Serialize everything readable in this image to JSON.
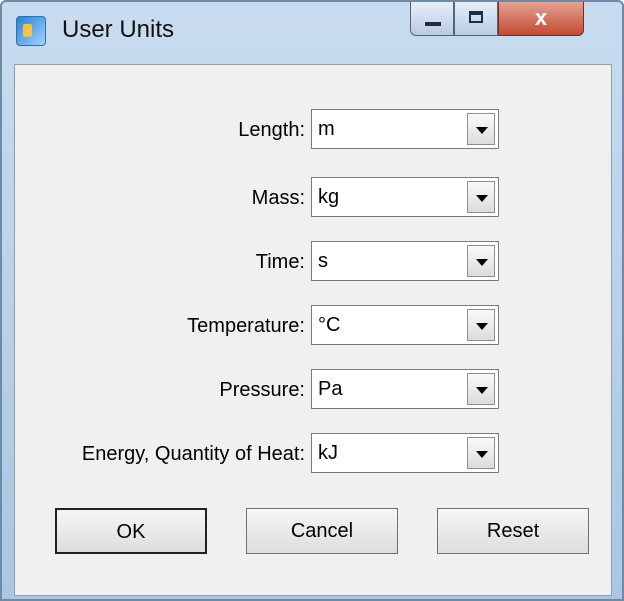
{
  "window": {
    "title": "User Units",
    "app_icon": "app-icon",
    "minimize_glyph": "",
    "maximize_glyph": "",
    "close_glyph": "x"
  },
  "fields": [
    {
      "label": "Length:",
      "value": "m"
    },
    {
      "label": "Mass:",
      "value": "kg"
    },
    {
      "label": "Time:",
      "value": "s"
    },
    {
      "label": "Temperature:",
      "value": "°C"
    },
    {
      "label": "Pressure:",
      "value": "Pa"
    },
    {
      "label": "Energy, Quantity of Heat:",
      "value": "kJ"
    }
  ],
  "buttons": {
    "ok": "OK",
    "cancel": "Cancel",
    "reset": "Reset"
  }
}
